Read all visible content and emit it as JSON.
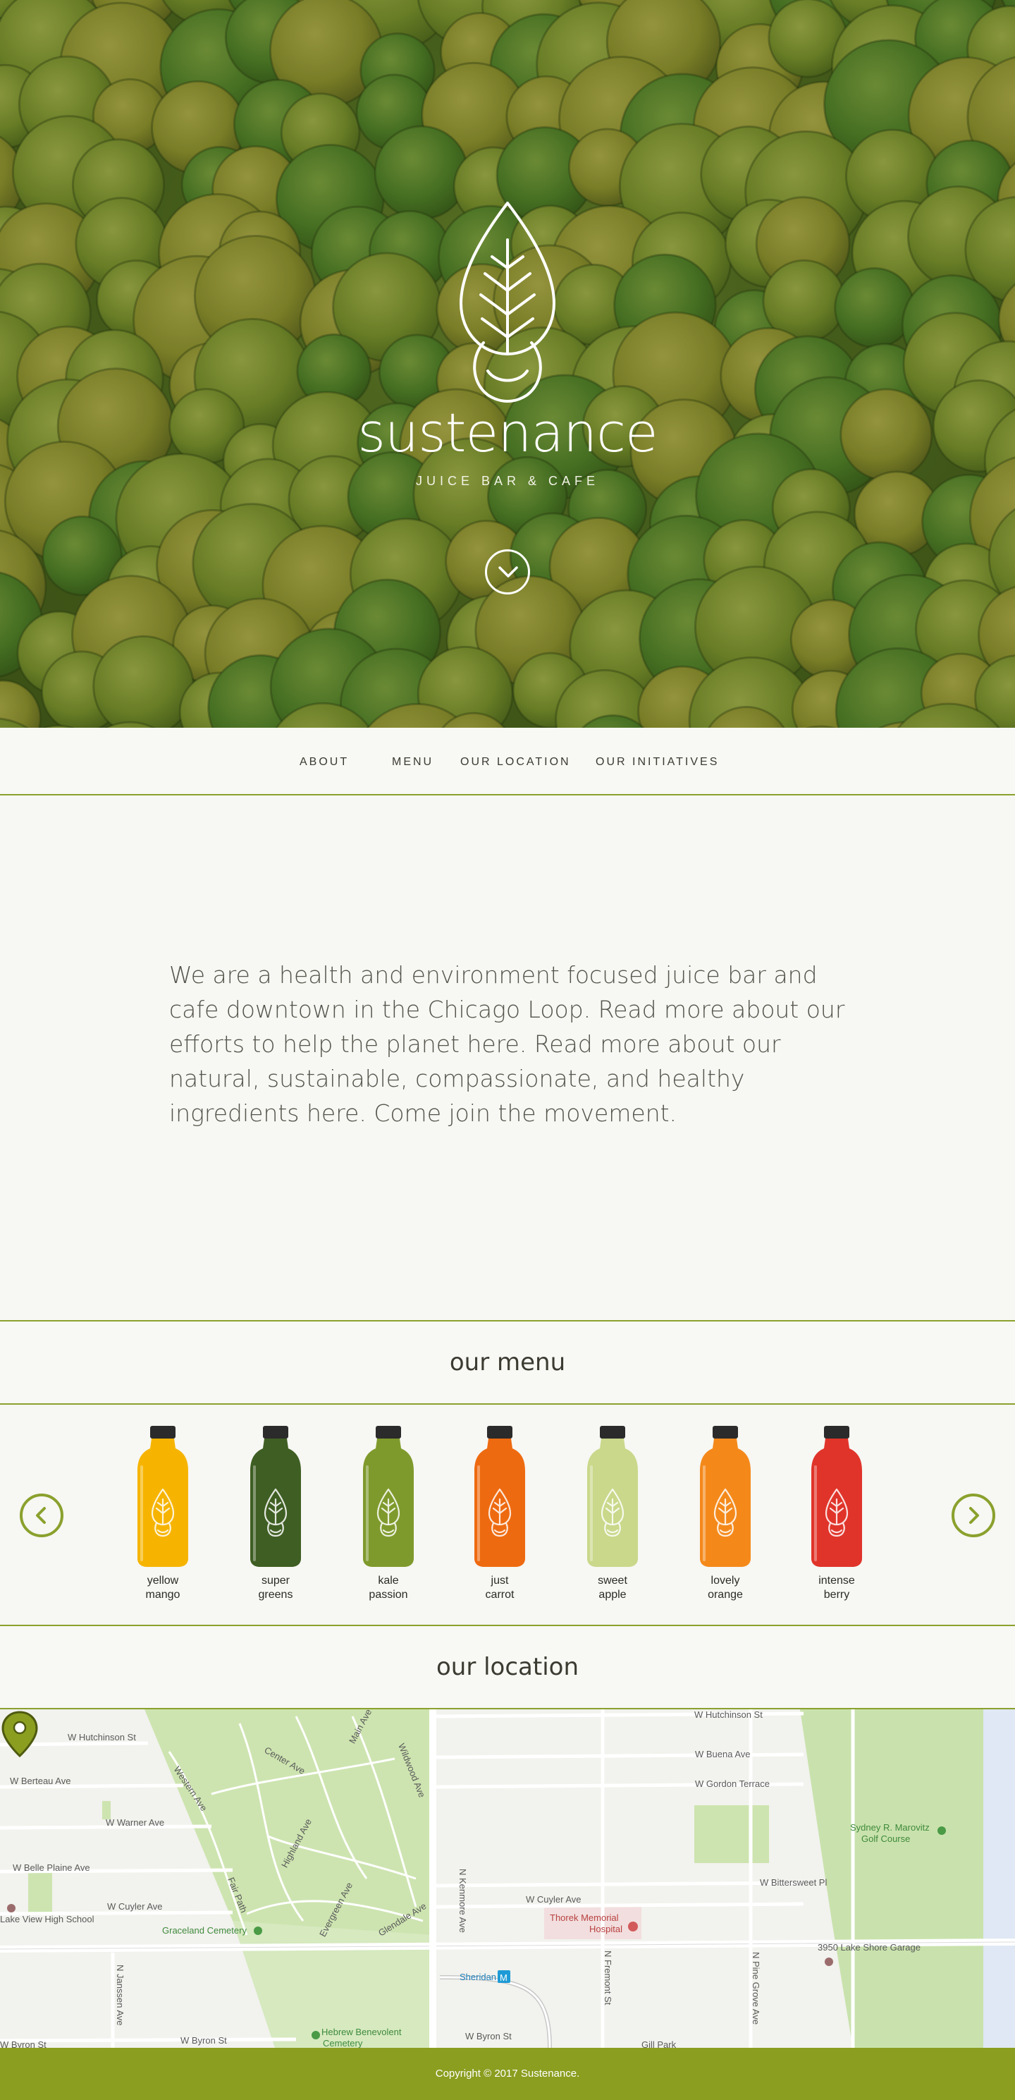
{
  "hero": {
    "brand": "sustenance",
    "tagline": "JUICE BAR & CAFE",
    "scroll_icon": "chevron-down-circle-icon",
    "overlay_color": "#3f5a17"
  },
  "nav": {
    "items": [
      {
        "label": "ABOUT"
      },
      {
        "label": "MENU"
      },
      {
        "label": "OUR LOCATION"
      },
      {
        "label": "OUR INITIATIVES"
      }
    ]
  },
  "intro": {
    "text": "We are a health and environment focused juice bar and cafe downtown in the Chicago Loop. Read more about our efforts to help the planet here. Read more about our natural, sustainable, compassionate, and healthy ingredients here. Come join the movement."
  },
  "menu": {
    "heading": "our menu",
    "prev_icon": "chevron-left-icon",
    "next_icon": "chevron-right-icon",
    "items": [
      {
        "line1": "yellow",
        "line2": "mango",
        "color": "#f6b400"
      },
      {
        "line1": "super",
        "line2": "greens",
        "color": "#3f5e23"
      },
      {
        "line1": "kale",
        "line2": "passion",
        "color": "#7f9a2c"
      },
      {
        "line1": "just",
        "line2": "carrot",
        "color": "#ee6a10"
      },
      {
        "line1": "sweet",
        "line2": "apple",
        "color": "#c9d88a"
      },
      {
        "line1": "lovely",
        "line2": "orange",
        "color": "#f4891a"
      },
      {
        "line1": "intense",
        "line2": "berry",
        "color": "#e0342a"
      }
    ]
  },
  "location": {
    "heading": "our location",
    "pin_icon": "map-pin-icon",
    "labels": {
      "w_hutchinson_1": "W Hutchinson St",
      "w_hutchinson_2": "W Hutchinson St",
      "w_berteau": "W Berteau Ave",
      "w_warner": "W Warner Ave",
      "w_belle_plaine": "W Belle Plaine Ave",
      "lake_view_hs": "Lake View High School",
      "w_cuyler_1": "W Cuyler Ave",
      "w_cuyler_2": "W Cuyler Ave",
      "graceland": "Graceland Cemetery",
      "w_buena": "W Buena Ave",
      "w_gordon": "W Gordon Terrace",
      "w_bittersweet": "W Bittersweet Pl",
      "sydney": "Sydney R. Marovitz",
      "golf": "Golf Course",
      "garage": "3950 Lake Shore Garage",
      "thorek_1": "Thorek Memorial",
      "thorek_2": "Hospital",
      "sheridan": "Sheridan",
      "hebrew_1": "Hebrew Benevolent",
      "hebrew_2": "Cemetery",
      "w_byron_1": "W Byron St",
      "w_byron_2": "W Byron St",
      "w_byron_3": "W Byron St",
      "n_kenmore": "N Kenmore Ave",
      "n_fremont": "N Fremont St",
      "n_pine_grove": "N Pine Grove Ave",
      "n_janssen": "N Janssen Ave",
      "center_ave": "Center Ave",
      "western_ave": "Western Ave",
      "highland_ave": "Highland Ave",
      "main_ave": "Main Ave",
      "wildwood_ave": "Wildwood Ave",
      "fair_path": "Fair Path",
      "evergreen_ave": "Evergreen Ave",
      "glendale_ave": "Glendale Ave",
      "gill_park": "Gill Park"
    }
  },
  "footer": {
    "copyright": "Copyright © 2017 Sustenance."
  }
}
